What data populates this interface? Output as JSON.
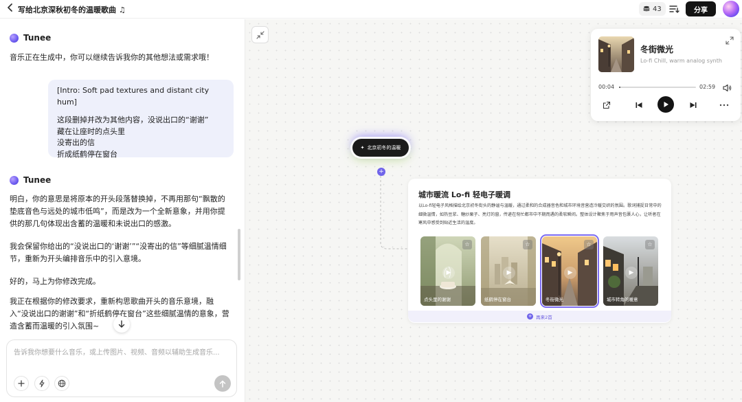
{
  "header": {
    "back_icon": "chevron-left-icon",
    "title": "写给北京深秋初冬的温暖歌曲 ♫",
    "credits": "43",
    "share_label": "分享"
  },
  "chat": {
    "bot_name": "Tunee",
    "message1": "音乐正在生成中，你可以继续告诉我你的其他想法或需求哦！",
    "user_message": {
      "line1": "[Intro: Soft pad textures and distant city hum]",
      "line2": "这段删掉并改为其他内容，没说出口的“谢谢”",
      "line3": "藏在让座时的点头里",
      "line4": "没寄出的信",
      "line5": "折成纸鹤停在窗台"
    },
    "reply": {
      "p1": "明白，你的意思是将原本的开头段落替换掉，不再用那句“飘散的垫底音色与远处的城市低鸣”，而是改为一个全新意象，并用你提供的那几句体现出含蓄的温暖和未说出口的感激。",
      "p2": "我会保留你给出的“没说出口的‘谢谢’”“没寄出的信”等细腻温情细节，重新为开头编排音乐中的引入意境。",
      "p3": "好的，马上为你修改完成。",
      "p4": "我正在根据你的修改要求，重新构思歌曲开头的音乐意境，融入“没说出口的谢谢”和“折纸鹤停在窗台”这些细腻温情的意象，营造含蓄而温暖的引入氛围~"
    },
    "composer_placeholder": "告诉我你想要什么音乐，或上传图片、视频、音频以辅助生成音乐..."
  },
  "canvas": {
    "prompt_node_label": "北京初冬的温暖",
    "card": {
      "title": "城市暖流 Lo-fi 轻电子暖调",
      "description": "以Lo-fi轻电子风格描绘北京初冬街头的静谧与温暖，通过柔和的合成器音色和城市环境音营造冷暖交织的氛围。歌词捕捉日常中的细微温情，如热豆浆、糖炒栗子、亮灯的窗，传递在匆忙都市中不期而遇的柔软瞬间。整体设计聚焦于用声音包裹人心，让听者在寒风中感受到贴近生活的温度。",
      "tracks": [
        {
          "label": "点头里的谢谢",
          "selected": false
        },
        {
          "label": "纸鹤停在窗台",
          "selected": false
        },
        {
          "label": "冬街微光",
          "selected": true
        },
        {
          "label": "城市转角的暖意",
          "selected": false
        }
      ],
      "more_label": "再来2首"
    }
  },
  "player": {
    "title": "冬街微光",
    "subtitle": "Lo-fi Chill, warm analog synth",
    "current_time": "00:04",
    "total_time": "02:59",
    "progress": 0.022
  },
  "colors": {
    "accent": "#7064ea",
    "selected_outline": "#7c6cf2",
    "share_bg": "#141414"
  }
}
